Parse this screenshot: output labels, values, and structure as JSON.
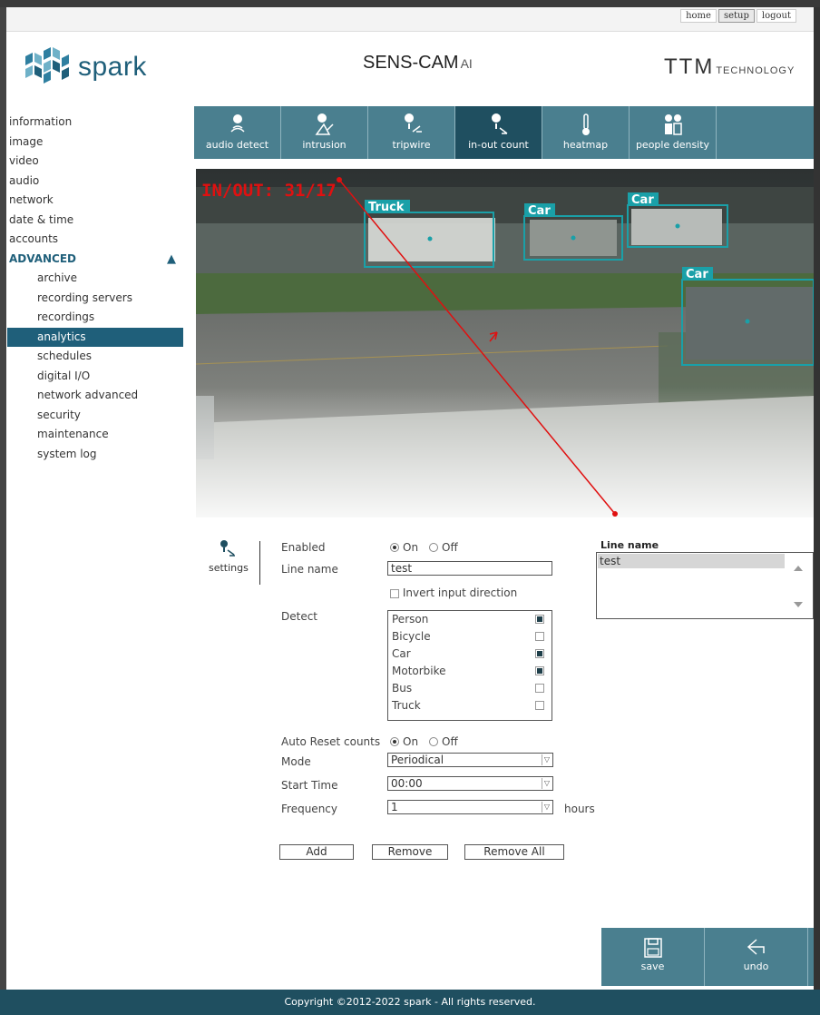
{
  "toplinks": {
    "home": "home",
    "setup": "setup",
    "logout": "logout"
  },
  "header": {
    "logo_text": "spark",
    "title": "SENS-CAM",
    "title_suffix": "AI",
    "brand_big": "TTM",
    "brand_small": "TECHNOLOGY"
  },
  "sidebar": {
    "items": [
      "information",
      "image",
      "video",
      "audio",
      "network",
      "date & time",
      "accounts"
    ],
    "advanced": "ADVANCED",
    "subitems": [
      "archive",
      "recording servers",
      "recordings",
      "analytics",
      "schedules",
      "digital I/O",
      "network advanced",
      "security",
      "maintenance",
      "system log"
    ],
    "selected": "analytics"
  },
  "tabs": [
    {
      "label": "audio detect",
      "icon": "audio-detect-icon"
    },
    {
      "label": "intrusion",
      "icon": "intrusion-icon"
    },
    {
      "label": "tripwire",
      "icon": "tripwire-icon"
    },
    {
      "label": "in-out count",
      "icon": "in-out-count-icon",
      "active": true
    },
    {
      "label": "heatmap",
      "icon": "heatmap-icon"
    },
    {
      "label": "people density",
      "icon": "people-density-icon"
    }
  ],
  "video": {
    "counter": "IN/OUT: 31/17",
    "boxes": [
      "Truck",
      "Car",
      "Car",
      "Car"
    ]
  },
  "settings": {
    "label": "settings",
    "enabled_label": "Enabled",
    "on": "On",
    "off": "Off",
    "enabled": "On",
    "line_name_label": "Line name",
    "line_name_value": "test",
    "invert_label": "Invert input direction",
    "invert_checked": false,
    "detect_label": "Detect",
    "detect": [
      {
        "name": "Person",
        "checked": true
      },
      {
        "name": "Bicycle",
        "checked": false
      },
      {
        "name": "Car",
        "checked": true
      },
      {
        "name": "Motorbike",
        "checked": true
      },
      {
        "name": "Bus",
        "checked": false
      },
      {
        "name": "Truck",
        "checked": false
      }
    ],
    "auto_reset_label": "Auto Reset counts",
    "auto_reset": "On",
    "mode_label": "Mode",
    "mode_value": "Periodical",
    "start_time_label": "Start Time",
    "start_time_value": "00:00",
    "frequency_label": "Frequency",
    "frequency_value": "1",
    "frequency_unit": "hours",
    "add": "Add",
    "remove": "Remove",
    "remove_all": "Remove All"
  },
  "linelist": {
    "title": "Line name",
    "items": [
      "test"
    ]
  },
  "actions": {
    "save": "save",
    "undo": "undo"
  },
  "footer": "Copyright ©2012-2022 spark - All rights reserved.",
  "colors": {
    "accent": "#4a7f8f",
    "dark": "#1f4f60",
    "detect_box": "#1aa0a8",
    "counter": "#e01010"
  }
}
